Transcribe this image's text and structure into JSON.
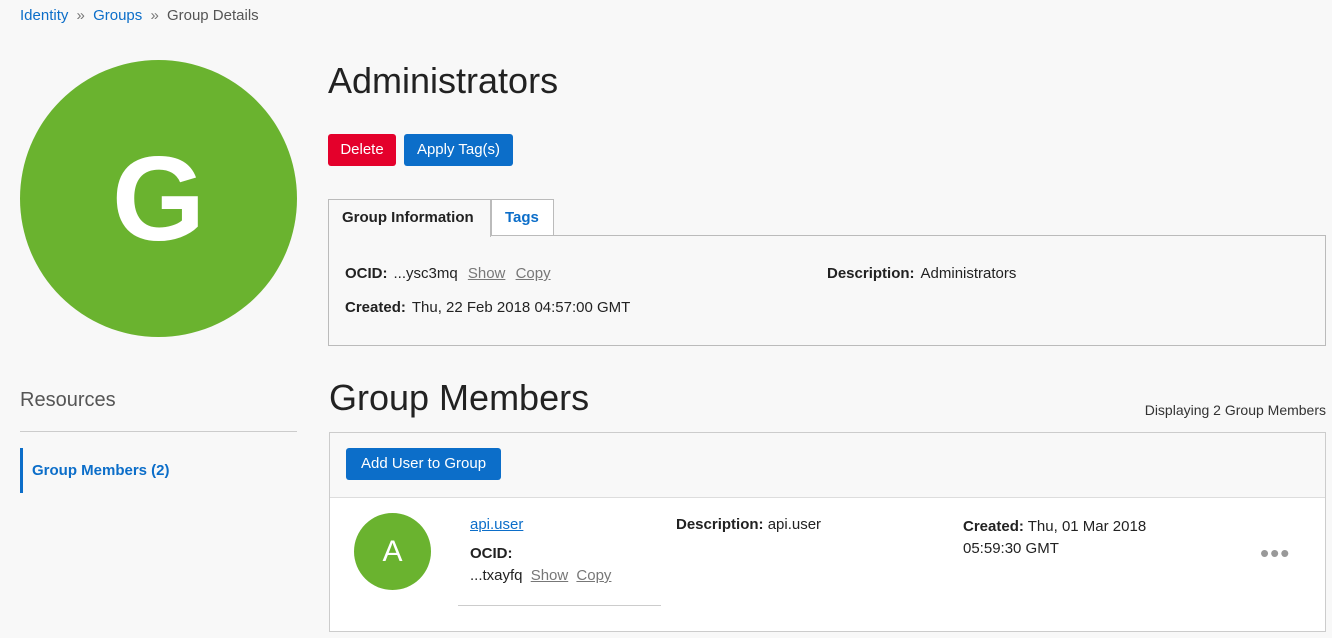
{
  "breadcrumb": {
    "identity": "Identity",
    "sep1": "»",
    "groups": "Groups",
    "sep2": "»",
    "current": "Group Details"
  },
  "group": {
    "avatar_letter": "G",
    "avatar_color": "#6ab32f",
    "name": "Administrators"
  },
  "actions": {
    "delete_label": "Delete",
    "apply_tags_label": "Apply Tag(s)"
  },
  "tabs": {
    "info": "Group Information",
    "tags": "Tags"
  },
  "info": {
    "ocid_label": "OCID:",
    "ocid_value": "...ysc3mq",
    "show": "Show",
    "copy": "Copy",
    "description_label": "Description:",
    "description_value": "Administrators",
    "created_label": "Created:",
    "created_value": "Thu, 22 Feb 2018 04:57:00 GMT"
  },
  "resources": {
    "title": "Resources",
    "items": [
      {
        "label": "Group Members (2)"
      }
    ]
  },
  "members_section": {
    "title": "Group Members",
    "displaying": "Displaying 2 Group Members",
    "add_button": "Add User to Group",
    "members": [
      {
        "avatar_letter": "A",
        "name": "api.user",
        "ocid_label": "OCID:",
        "ocid_value": "...txayfq",
        "show": "Show",
        "copy": "Copy",
        "description_label": "Description:",
        "description_value": "api.user",
        "created_label": "Created:",
        "created_line1": "Thu, 01 Mar 2018",
        "created_line2": "05:59:30 GMT",
        "actions_icon": "•••"
      }
    ]
  },
  "colors": {
    "primary": "#0c6ec9",
    "danger": "#e4002b",
    "avatar": "#6ab32f"
  }
}
